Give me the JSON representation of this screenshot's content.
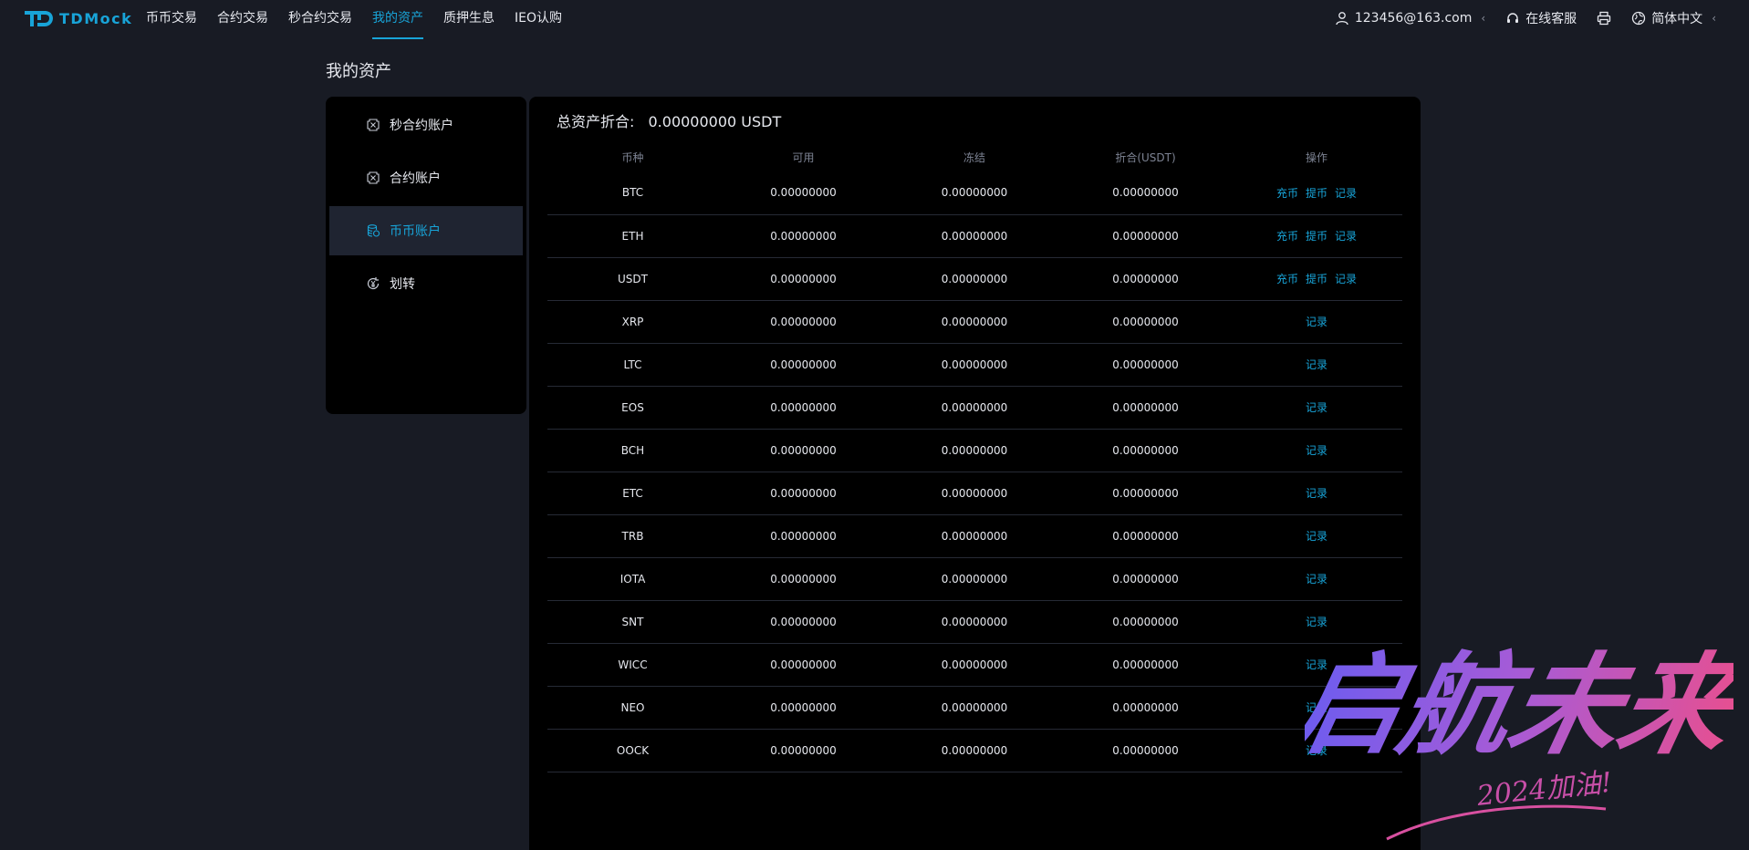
{
  "header": {
    "logo_text": "TDMock",
    "nav": [
      {
        "label": "币币交易"
      },
      {
        "label": "合约交易"
      },
      {
        "label": "秒合约交易"
      },
      {
        "label": "我的资产"
      },
      {
        "label": "质押生息"
      },
      {
        "label": "IEO认购"
      }
    ],
    "active_nav": "我的资产",
    "user_email": "123456@163.com",
    "support_label": "在线客服",
    "language_label": "简体中文",
    "accent_color": "#18a4d8"
  },
  "page": {
    "title": "我的资产"
  },
  "sidebar": {
    "items": [
      {
        "label": "秒合约账户",
        "icon": "contract-icon"
      },
      {
        "label": "合约账户",
        "icon": "contract-icon"
      },
      {
        "label": "币币账户",
        "icon": "coins-icon"
      },
      {
        "label": "划转",
        "icon": "transfer-icon"
      }
    ],
    "active_item": "币币账户"
  },
  "summary": {
    "total_label": "总资产折合:",
    "total_value": "0.00000000 USDT"
  },
  "table": {
    "columns": [
      "币种",
      "可用",
      "冻结",
      "折合(USDT)",
      "操作"
    ],
    "action_labels": {
      "deposit": "充币",
      "withdraw": "提币",
      "record": "记录"
    },
    "rows": [
      {
        "coin": "BTC",
        "available": "0.00000000",
        "frozen": "0.00000000",
        "usdt": "0.00000000",
        "actions": [
          "充币",
          "提币",
          "记录"
        ]
      },
      {
        "coin": "ETH",
        "available": "0.00000000",
        "frozen": "0.00000000",
        "usdt": "0.00000000",
        "actions": [
          "充币",
          "提币",
          "记录"
        ]
      },
      {
        "coin": "USDT",
        "available": "0.00000000",
        "frozen": "0.00000000",
        "usdt": "0.00000000",
        "actions": [
          "充币",
          "提币",
          "记录"
        ]
      },
      {
        "coin": "XRP",
        "available": "0.00000000",
        "frozen": "0.00000000",
        "usdt": "0.00000000",
        "actions": [
          "记录"
        ]
      },
      {
        "coin": "LTC",
        "available": "0.00000000",
        "frozen": "0.00000000",
        "usdt": "0.00000000",
        "actions": [
          "记录"
        ]
      },
      {
        "coin": "EOS",
        "available": "0.00000000",
        "frozen": "0.00000000",
        "usdt": "0.00000000",
        "actions": [
          "记录"
        ]
      },
      {
        "coin": "BCH",
        "available": "0.00000000",
        "frozen": "0.00000000",
        "usdt": "0.00000000",
        "actions": [
          "记录"
        ]
      },
      {
        "coin": "ETC",
        "available": "0.00000000",
        "frozen": "0.00000000",
        "usdt": "0.00000000",
        "actions": [
          "记录"
        ]
      },
      {
        "coin": "TRB",
        "available": "0.00000000",
        "frozen": "0.00000000",
        "usdt": "0.00000000",
        "actions": [
          "记录"
        ]
      },
      {
        "coin": "IOTA",
        "available": "0.00000000",
        "frozen": "0.00000000",
        "usdt": "0.00000000",
        "actions": [
          "记录"
        ]
      },
      {
        "coin": "SNT",
        "available": "0.00000000",
        "frozen": "0.00000000",
        "usdt": "0.00000000",
        "actions": [
          "记录"
        ]
      },
      {
        "coin": "WICC",
        "available": "0.00000000",
        "frozen": "0.00000000",
        "usdt": "0.00000000",
        "actions": [
          "记录"
        ]
      },
      {
        "coin": "NEO",
        "available": "0.00000000",
        "frozen": "0.00000000",
        "usdt": "0.00000000",
        "actions": [
          "记录"
        ]
      },
      {
        "coin": "OOCK",
        "available": "0.00000000",
        "frozen": "0.00000000",
        "usdt": "0.00000000",
        "actions": [
          "记录"
        ]
      }
    ]
  },
  "watermark": {
    "main_text": "启航未来",
    "sub_text": "2024加油!"
  }
}
